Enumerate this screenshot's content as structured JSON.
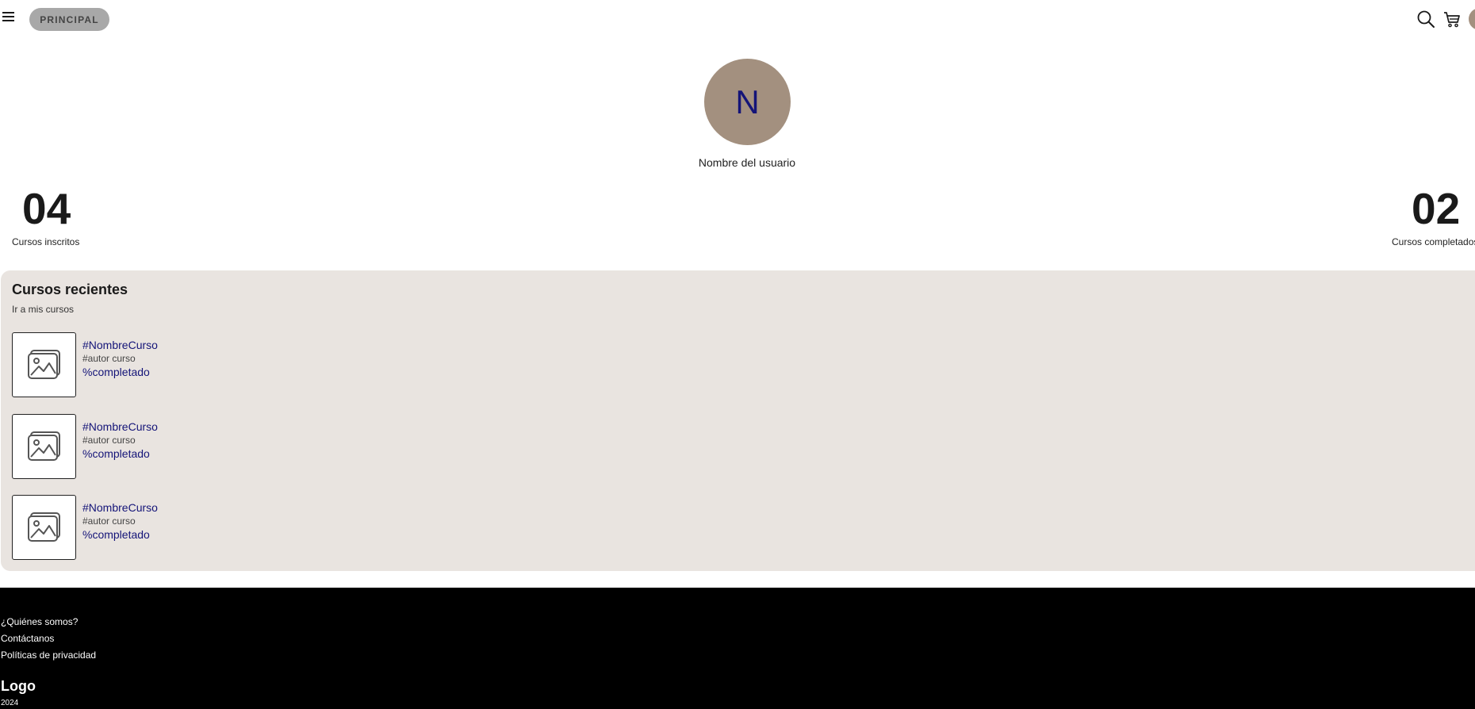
{
  "header": {
    "nav_label": "PRINCIPAL",
    "icons": [
      "menu-icon",
      "search-icon",
      "cart-icon",
      "avatar"
    ]
  },
  "profile": {
    "initial": "N",
    "name": "Nombre del usuario",
    "avatar_color": "#a3907f",
    "initial_color": "#141478"
  },
  "stats": {
    "enrolled_count": "04",
    "enrolled_label": "Cursos inscritos",
    "completed_count": "02",
    "completed_label": "Cursos completados"
  },
  "recent": {
    "title": "Cursos recientes",
    "link": "Ir a mis cursos",
    "background": "#e9e4e0",
    "courses": [
      {
        "name": "#NombreCurso",
        "author": "#autor curso",
        "progress": "%completado"
      },
      {
        "name": "#NombreCurso",
        "author": "#autor curso",
        "progress": "%completado"
      },
      {
        "name": "#NombreCurso",
        "author": "#autor curso",
        "progress": "%completado"
      }
    ]
  },
  "footer": {
    "links": [
      "¿Quiénes somos?",
      "Contáctanos",
      "Políticas de privacidad"
    ],
    "logo": "Logo",
    "year": "2024"
  }
}
